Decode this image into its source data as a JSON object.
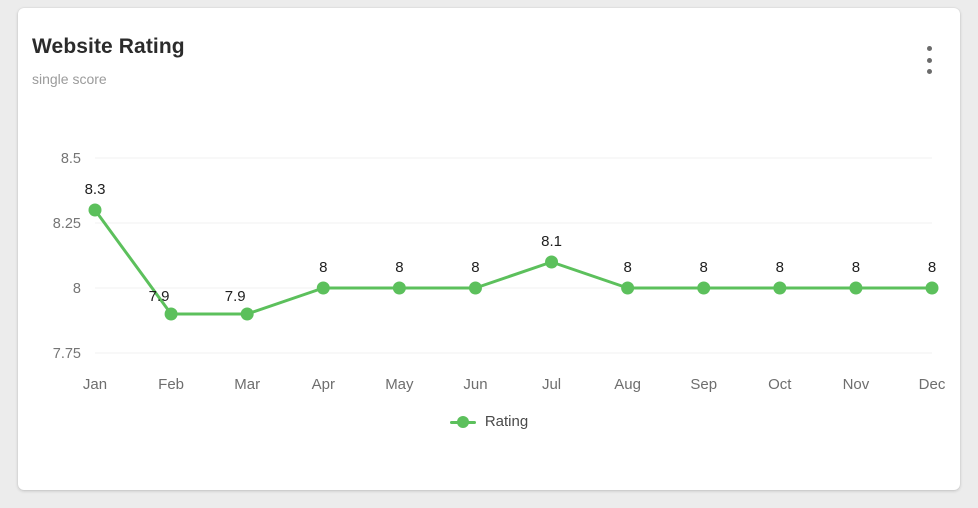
{
  "card": {
    "title": "Website Rating",
    "subtitle": "single score",
    "menu_icon": "kebab-menu-icon"
  },
  "legend": {
    "items": [
      {
        "label": "Rating",
        "color": "#5cc05c"
      }
    ]
  },
  "colors": {
    "series": "#5cc05c",
    "card_background": "#ffffff",
    "page_background": "#ececec",
    "gridline": "#f0f0f0",
    "title": "#2b2b2b",
    "subtitle": "#9b9b9b",
    "axis_label": "#6e6e6e"
  },
  "chart_data": {
    "type": "line",
    "title": "Website Rating",
    "subtitle": "single score",
    "xlabel": "",
    "ylabel": "",
    "categories": [
      "Jan",
      "Feb",
      "Mar",
      "Apr",
      "May",
      "Jun",
      "Jul",
      "Aug",
      "Sep",
      "Oct",
      "Nov",
      "Dec"
    ],
    "series": [
      {
        "name": "Rating",
        "color": "#5cc05c",
        "values": [
          8.3,
          7.9,
          7.9,
          8,
          8,
          8,
          8.1,
          8,
          8,
          8,
          8,
          8
        ],
        "data_labels": [
          "8.3",
          "7.9",
          "7.9",
          "8",
          "8",
          "8",
          "8.1",
          "8",
          "8",
          "8",
          "8",
          "8"
        ]
      }
    ],
    "ylim": [
      7.75,
      8.5
    ],
    "y_ticks": [
      8.5,
      8.25,
      8,
      7.75
    ],
    "y_tick_labels": [
      "8.5",
      "8.25",
      "8",
      "7.75"
    ],
    "grid": true,
    "grid_axis": "y",
    "legend_position": "bottom",
    "markers": true,
    "show_data_labels": true
  }
}
